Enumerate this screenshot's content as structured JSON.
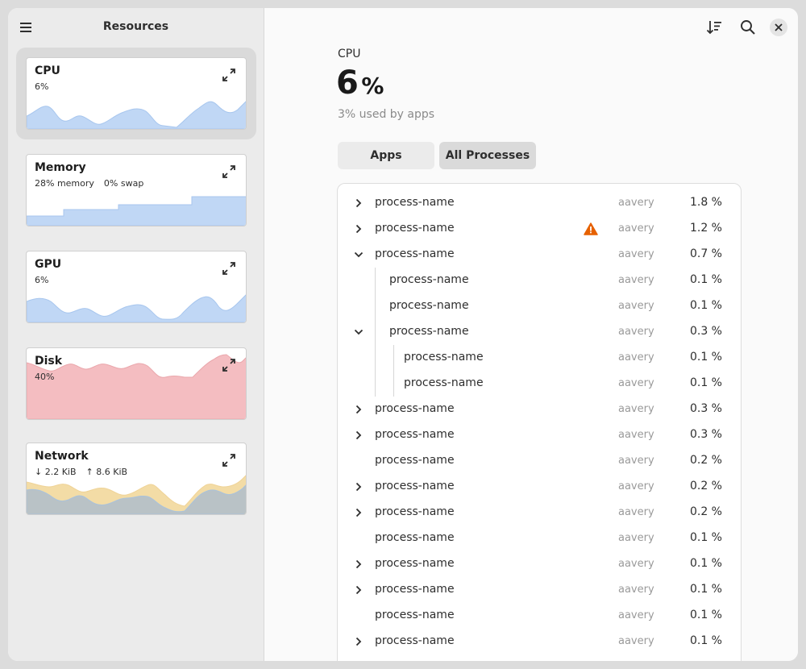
{
  "sidebar": {
    "title": "Resources",
    "menu_icon": "hamburger-menu-icon",
    "cards": [
      {
        "id": "cpu",
        "title": "CPU",
        "subs": [
          "6%"
        ],
        "color": "#c0d7f5",
        "stroke": "#9ec0ec",
        "selected": true
      },
      {
        "id": "memory",
        "title": "Memory",
        "subs": [
          "28% memory",
          "0% swap"
        ],
        "color": "#c0d7f5",
        "stroke": "#9ec0ec",
        "selected": false
      },
      {
        "id": "gpu",
        "title": "GPU",
        "subs": [
          "6%"
        ],
        "color": "#c0d7f5",
        "stroke": "#9ec0ec",
        "selected": false
      },
      {
        "id": "disk",
        "title": "Disk",
        "subs": [
          "40%"
        ],
        "color": "#f4bdc1",
        "stroke": "#e9a1a7",
        "selected": false
      },
      {
        "id": "network",
        "title": "Network",
        "subs": [
          "↓ 2.2 KiB",
          "↑ 8.6 KiB"
        ],
        "color": "#b9c2c6",
        "stroke": "#f3dca6",
        "selected": false
      }
    ]
  },
  "header": {
    "sort_icon": "sort-descending-icon",
    "search_icon": "search-icon",
    "close_icon": "close-icon"
  },
  "main": {
    "section": "CPU",
    "value": "6",
    "unit": "%",
    "note": "3% used by apps",
    "tabs": [
      {
        "label": "Apps",
        "active": false
      },
      {
        "label": "All Processes",
        "active": true
      }
    ]
  },
  "processes": [
    {
      "name": "process-name",
      "user": "aavery",
      "cpu": "1.8 %",
      "level": 0,
      "expander": "collapsed",
      "warning": false
    },
    {
      "name": "process-name",
      "user": "aavery",
      "cpu": "1.2 %",
      "level": 0,
      "expander": "collapsed",
      "warning": true
    },
    {
      "name": "process-name",
      "user": "aavery",
      "cpu": "0.7 %",
      "level": 0,
      "expander": "expanded",
      "warning": false
    },
    {
      "name": "process-name",
      "user": "aavery",
      "cpu": "0.1 %",
      "level": 1,
      "expander": "none",
      "warning": false
    },
    {
      "name": "process-name",
      "user": "aavery",
      "cpu": "0.1 %",
      "level": 1,
      "expander": "none",
      "warning": false
    },
    {
      "name": "process-name",
      "user": "aavery",
      "cpu": "0.3 %",
      "level": 1,
      "expander": "expanded",
      "warning": false
    },
    {
      "name": "process-name",
      "user": "aavery",
      "cpu": "0.1 %",
      "level": 2,
      "expander": "none",
      "warning": false
    },
    {
      "name": "process-name",
      "user": "aavery",
      "cpu": "0.1 %",
      "level": 2,
      "expander": "none",
      "warning": false
    },
    {
      "name": "process-name",
      "user": "aavery",
      "cpu": "0.3 %",
      "level": 0,
      "expander": "collapsed",
      "warning": false
    },
    {
      "name": "process-name",
      "user": "aavery",
      "cpu": "0.3 %",
      "level": 0,
      "expander": "collapsed",
      "warning": false
    },
    {
      "name": "process-name",
      "user": "aavery",
      "cpu": "0.2 %",
      "level": 0,
      "expander": "none",
      "warning": false
    },
    {
      "name": "process-name",
      "user": "aavery",
      "cpu": "0.2 %",
      "level": 0,
      "expander": "collapsed",
      "warning": false
    },
    {
      "name": "process-name",
      "user": "aavery",
      "cpu": "0.2 %",
      "level": 0,
      "expander": "collapsed",
      "warning": false
    },
    {
      "name": "process-name",
      "user": "aavery",
      "cpu": "0.1 %",
      "level": 0,
      "expander": "none",
      "warning": false
    },
    {
      "name": "process-name",
      "user": "aavery",
      "cpu": "0.1 %",
      "level": 0,
      "expander": "collapsed",
      "warning": false
    },
    {
      "name": "process-name",
      "user": "aavery",
      "cpu": "0.1 %",
      "level": 0,
      "expander": "collapsed",
      "warning": false
    },
    {
      "name": "process-name",
      "user": "aavery",
      "cpu": "0.1 %",
      "level": 0,
      "expander": "none",
      "warning": false
    },
    {
      "name": "process-name",
      "user": "aavery",
      "cpu": "0.1 %",
      "level": 0,
      "expander": "collapsed",
      "warning": false
    }
  ],
  "colors": {
    "warning": "#e66100",
    "accent_blue": "#c0d7f5",
    "disk_red": "#f4bdc1",
    "network_yellow": "#f3dca6"
  }
}
